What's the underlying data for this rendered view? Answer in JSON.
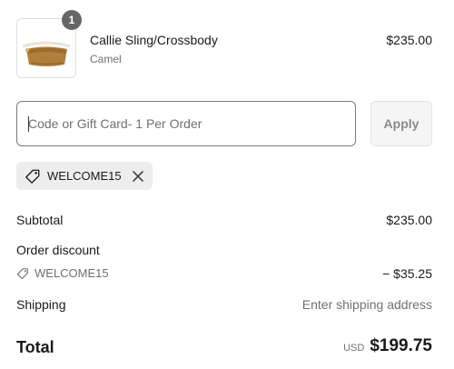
{
  "cart": {
    "item": {
      "quantity": "1",
      "name": "Callie Sling/Crossbody",
      "variant": "Camel",
      "price": "$235.00"
    }
  },
  "discount_form": {
    "placeholder": "Code or Gift Card- 1 Per Order",
    "value": "",
    "apply_label": "Apply"
  },
  "applied_code": {
    "code": "WELCOME15"
  },
  "summary": {
    "subtotal_label": "Subtotal",
    "subtotal_value": "$235.00",
    "order_discount_label": "Order discount",
    "discount_code": "WELCOME15",
    "discount_value": "− $35.25",
    "shipping_label": "Shipping",
    "shipping_value": "Enter shipping address",
    "total_label": "Total",
    "currency": "USD",
    "total_value": "$199.75"
  },
  "colors": {
    "badge": "#666666",
    "input_border": "#7a7a7a",
    "tag_background": "#ededed",
    "muted_text": "#707070"
  },
  "icons": [
    "camel-bag-thumbnail",
    "tag-icon",
    "close-icon"
  ]
}
